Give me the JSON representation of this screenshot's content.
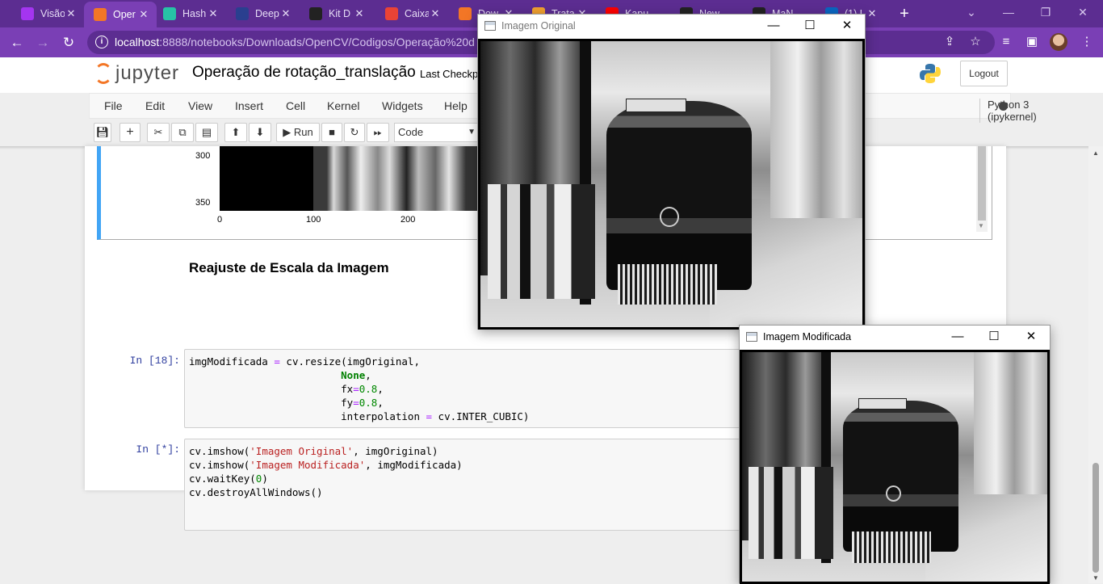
{
  "browser": {
    "tabs": [
      {
        "title": "Visão",
        "icon": "udemy-icon",
        "color": "#a435f0"
      },
      {
        "title": "Oper",
        "icon": "hourglass-icon",
        "color": "#f37626",
        "active": true
      },
      {
        "title": "Hash",
        "icon": "hashtag-icon",
        "color": "#27c3a6"
      },
      {
        "title": "Deep",
        "icon": "deepnote-icon",
        "color": "#2a3f8f"
      },
      {
        "title": "Kit D",
        "icon": "lightning-icon",
        "color": "#222222"
      },
      {
        "title": "Caixa",
        "icon": "gmail-icon",
        "color": "#ea4335"
      },
      {
        "title": "Dow",
        "icon": "jupyter-icon",
        "color": "#f37626"
      },
      {
        "title": "Trata",
        "icon": "doc-icon",
        "color": "#f0a030"
      },
      {
        "title": "Kapu",
        "icon": "youtube-icon",
        "color": "#ff0000"
      },
      {
        "title": "New",
        "icon": "github-icon",
        "color": "#222222"
      },
      {
        "title": "MaN",
        "icon": "github-icon",
        "color": "#222222"
      },
      {
        "title": "(1) L",
        "icon": "linkedin-icon",
        "color": "#0a66c2"
      }
    ],
    "url_host": "localhost",
    "url_path": ":8888/notebooks/Downloads/OpenCV/Codigos/Operação%20d"
  },
  "jupyter": {
    "logo_text": "jupyter",
    "notebook_name": "Operação de rotação_translação",
    "checkpoint": "Last Checkp",
    "logout_label": "Logout",
    "menu": [
      "File",
      "Edit",
      "View",
      "Insert",
      "Cell",
      "Kernel",
      "Widgets",
      "Help"
    ],
    "kernel_name": "Python 3 (ipykernel)",
    "run_label": "Run",
    "cell_type": "Code"
  },
  "plot": {
    "y_ticks": [
      "300",
      "350"
    ],
    "x_ticks": [
      "0",
      "100",
      "200"
    ]
  },
  "heading": "Reajuste de Escala da Imagem",
  "cells": [
    {
      "prompt": "In [18]:"
    },
    {
      "prompt": "In [*]:"
    }
  ],
  "windows": {
    "original": {
      "title": "Imagem Original"
    },
    "modified": {
      "title": "Imagem Modificada"
    }
  }
}
